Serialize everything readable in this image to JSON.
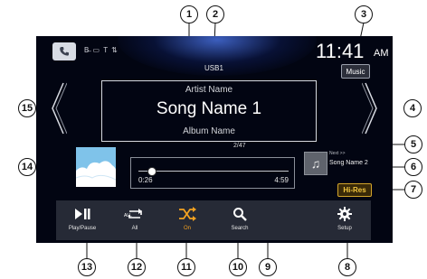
{
  "status": {
    "icons_text": "B̶ ▭ T ⇅",
    "source": "USB1",
    "clock": "11:41",
    "ampm": "AM",
    "music_button": "Music"
  },
  "now_playing": {
    "artist": "Artist Name",
    "song": "Song Name 1",
    "album": "Album Name",
    "track_count": "2/47",
    "elapsed": "0:26",
    "total": "4:59",
    "progress_fraction": 0.087
  },
  "next": {
    "label": "Next >>",
    "song": "Song Name 2"
  },
  "hires_badge": "Hi-Res",
  "controls": [
    {
      "label": "Play/Pause",
      "icon": "play-pause-icon"
    },
    {
      "label": "All",
      "icon": "repeat-all-icon"
    },
    {
      "label": "On",
      "icon": "shuffle-icon"
    },
    {
      "label": "Search",
      "icon": "search-icon"
    },
    {
      "label": "",
      "icon": ""
    },
    {
      "label": "Setup",
      "icon": "gear-icon"
    }
  ],
  "colors": {
    "screen_bg": "#020512",
    "control_bar": "#262a36",
    "accent_orange": "#f3a221",
    "hires_gold": "#f2c640",
    "art_blue": "#7fc3ea"
  },
  "callouts": [
    "1",
    "2",
    "3",
    "4",
    "5",
    "6",
    "7",
    "8",
    "9",
    "10",
    "11",
    "12",
    "13",
    "14",
    "15"
  ]
}
